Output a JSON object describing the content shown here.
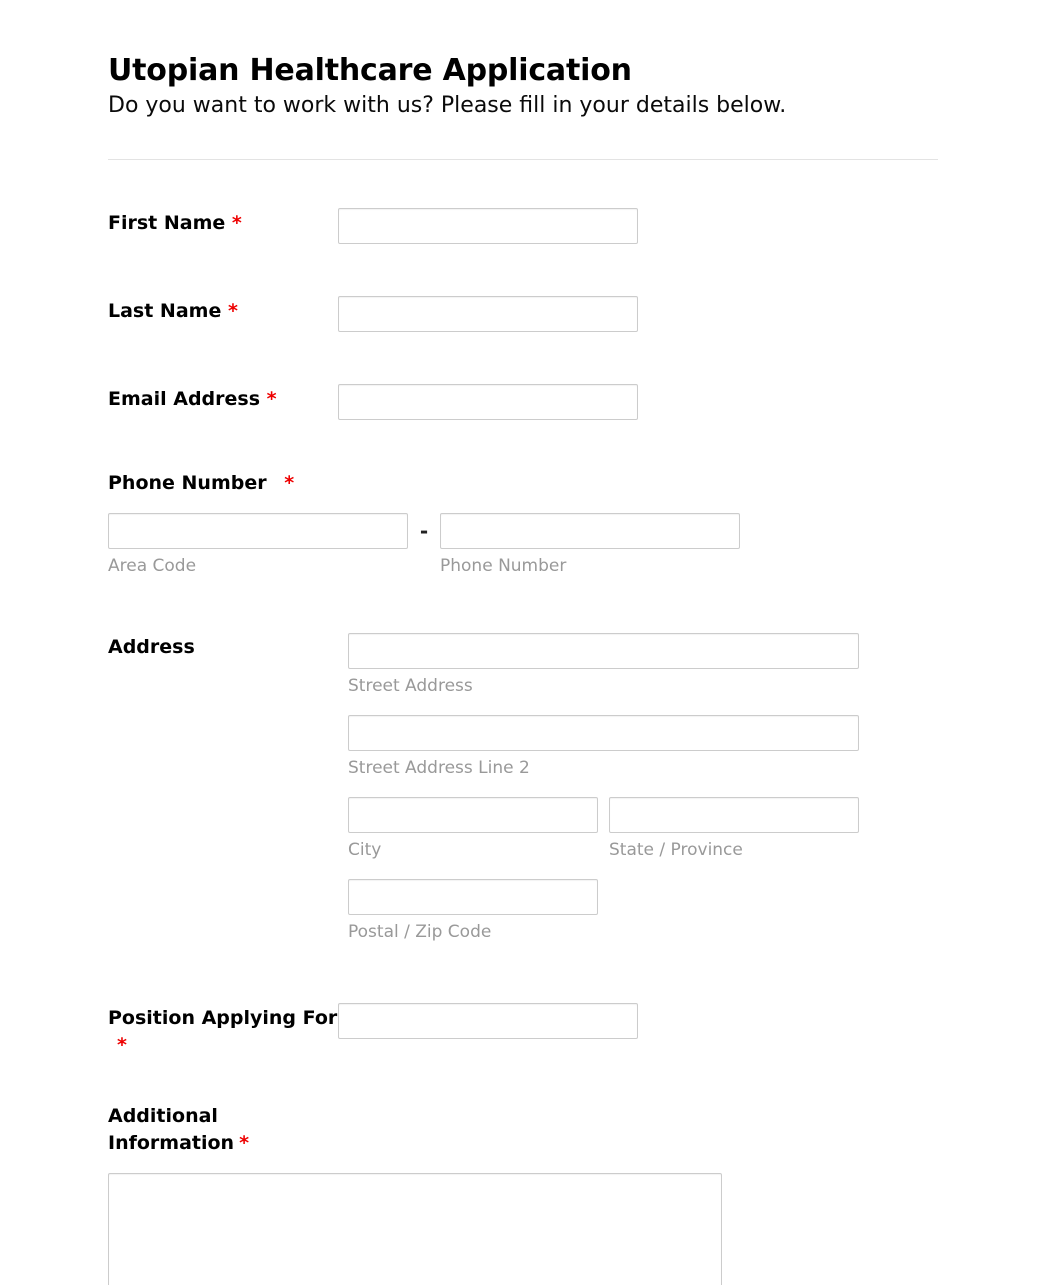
{
  "form": {
    "title": "Utopian Healthcare Application",
    "subtitle": "Do you want to work with us? Please fill in your details below.",
    "required_marker": "*",
    "accent_required_color": "#ee0000",
    "border_color": "#cccccc",
    "sublabel_color": "#999999",
    "divider_color": "#e3e3e3"
  },
  "fields": {
    "first_name": {
      "label": "First Name",
      "required": true,
      "value": "",
      "placeholder": ""
    },
    "last_name": {
      "label": "Last Name",
      "required": true,
      "value": "",
      "placeholder": ""
    },
    "email_address": {
      "label": "Email Address",
      "required": true,
      "value": "",
      "placeholder": ""
    },
    "phone_number": {
      "label": "Phone Number",
      "required": true,
      "separator": "-",
      "parts": [
        {
          "sub_label": "Area Code",
          "value": "",
          "placeholder": ""
        },
        {
          "sub_label": "Phone Number",
          "value": "",
          "placeholder": ""
        }
      ]
    },
    "address": {
      "label": "Address",
      "required": false,
      "parts": [
        {
          "sub_label": "Street Address",
          "value": "",
          "placeholder": ""
        },
        {
          "sub_label": "Street Address Line 2",
          "value": "",
          "placeholder": ""
        },
        {
          "sub_label": "City",
          "value": "",
          "placeholder": ""
        },
        {
          "sub_label": "State / Province",
          "value": "",
          "placeholder": ""
        },
        {
          "sub_label": "Postal / Zip Code",
          "value": "",
          "placeholder": ""
        }
      ]
    },
    "position_applying_for": {
      "label": "Position Applying For",
      "required": true,
      "value": "",
      "placeholder": ""
    },
    "additional_information": {
      "label": "Additional Information",
      "required": true,
      "value": "",
      "placeholder": ""
    }
  }
}
